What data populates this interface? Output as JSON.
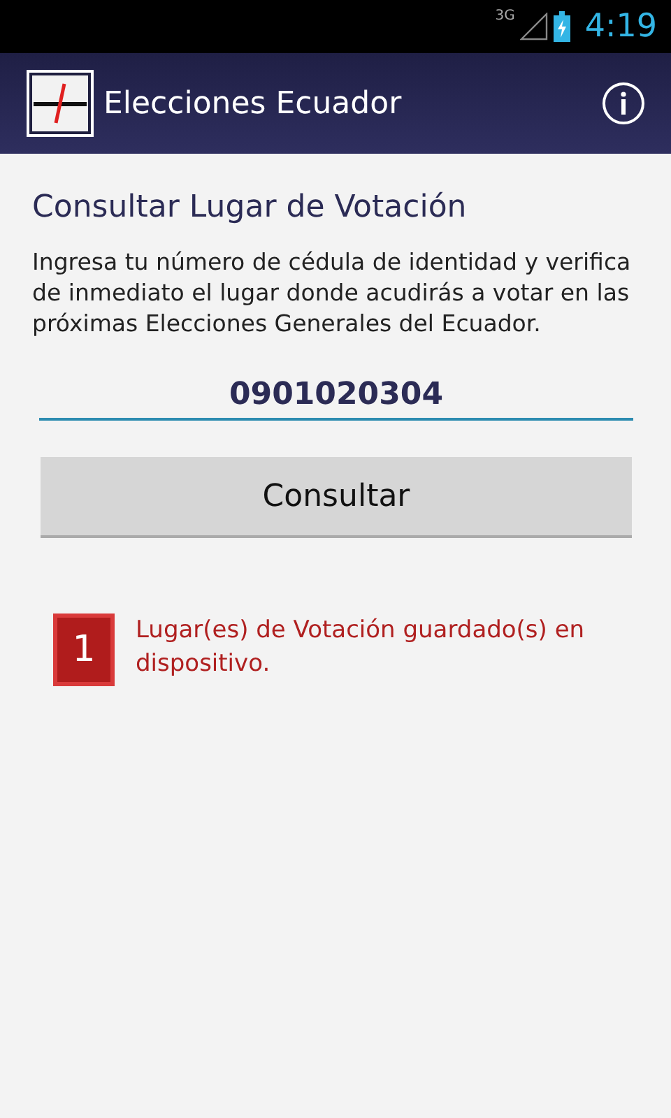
{
  "status_bar": {
    "network": "3G",
    "time": "4:19"
  },
  "app_bar": {
    "title": "Elecciones Ecuador"
  },
  "heading": "Consultar Lugar de Votación",
  "description": "Ingresa tu número de cédula de identidad y verifica de inmediato el lugar donde acudirás a votar en las próximas Elecciones Generales del Ecuador.",
  "id_field": {
    "value": "0901020304"
  },
  "submit_button": "Consultar",
  "saved": {
    "count": "1",
    "message": "Lugar(es) de Votación guardado(s) en dispositivo."
  }
}
